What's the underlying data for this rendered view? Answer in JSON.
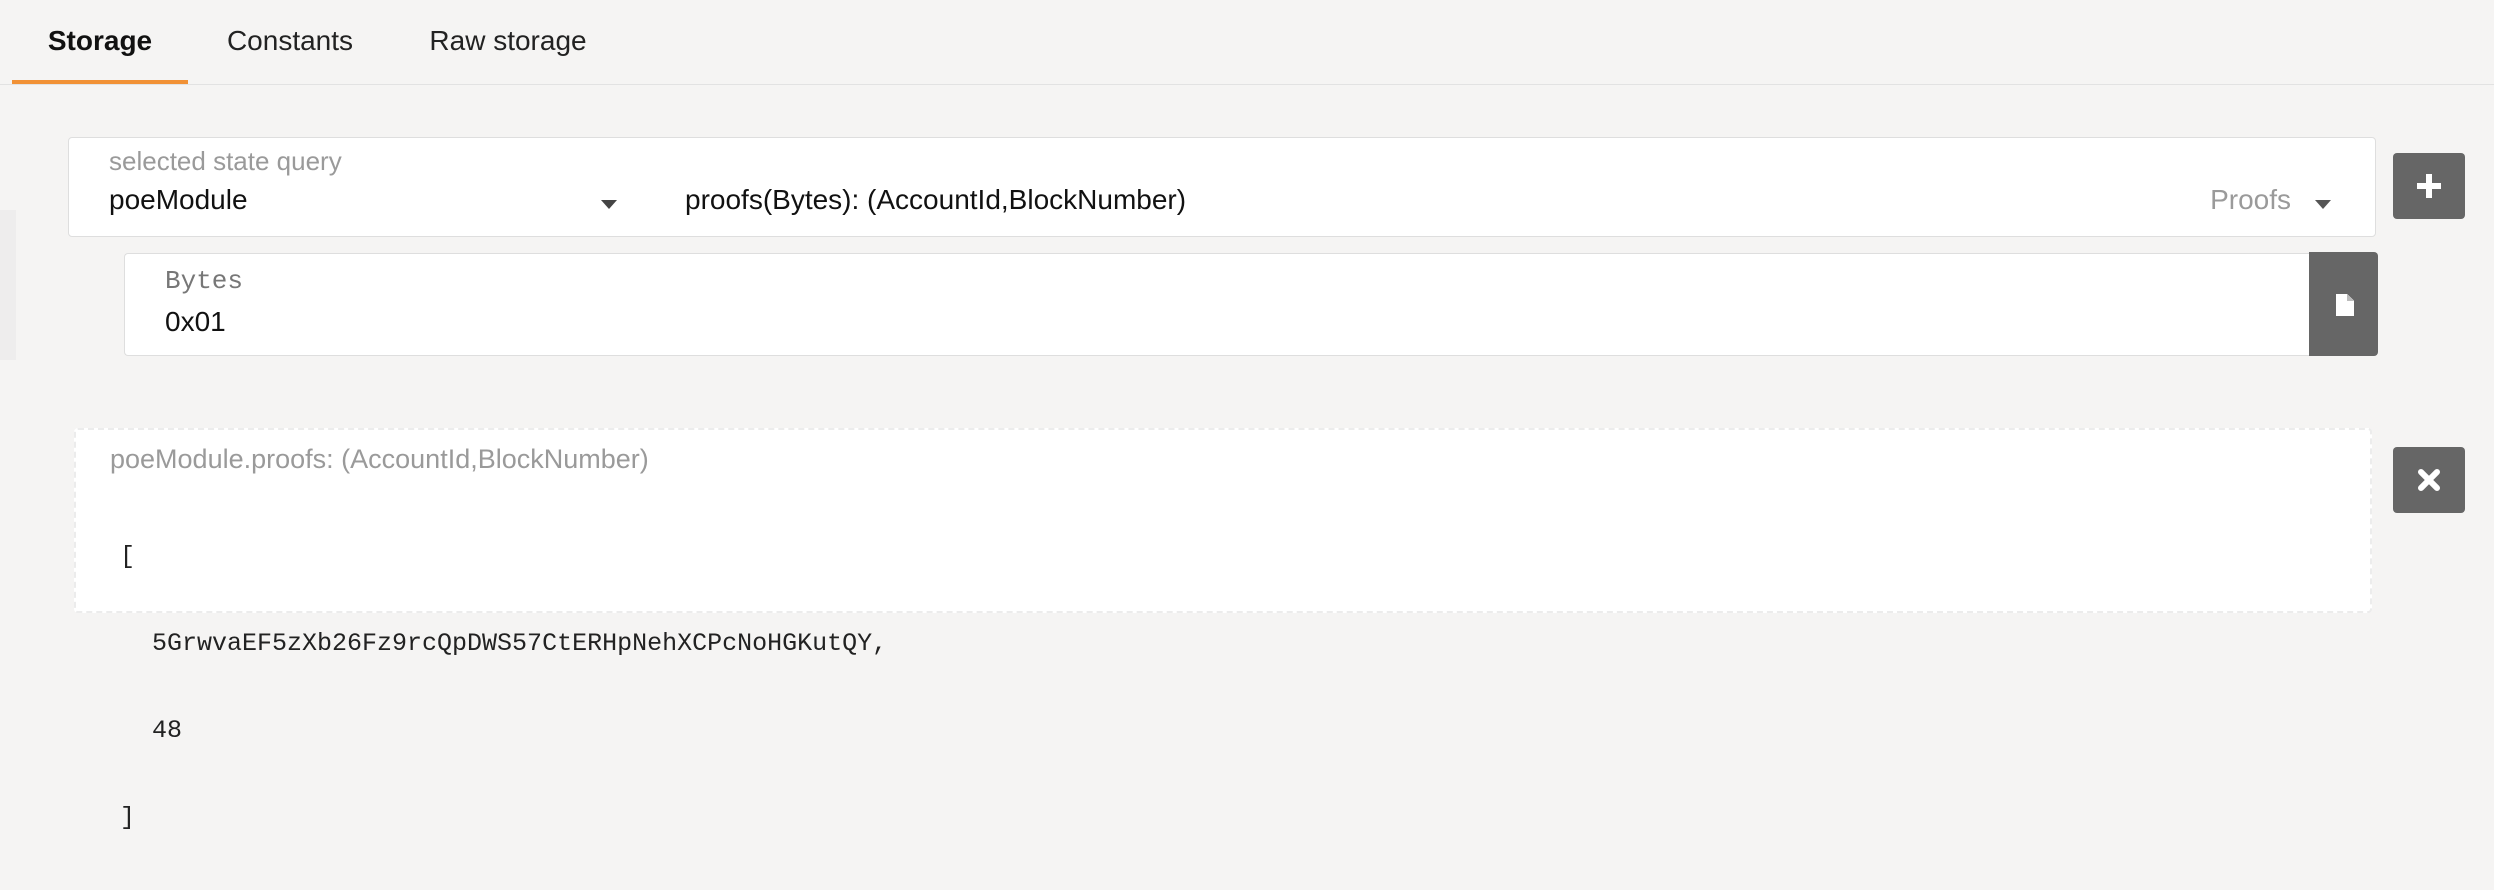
{
  "tabs": [
    {
      "label": "Storage",
      "active": true
    },
    {
      "label": "Constants",
      "active": false
    },
    {
      "label": "Raw storage",
      "active": false
    }
  ],
  "accent_color": "#f19135",
  "query": {
    "label": "selected state query",
    "module": "poeModule",
    "method": "proofs(Bytes): (AccountId,BlockNumber)",
    "section": "Proofs",
    "add_icon": "plus-icon"
  },
  "params": {
    "label": "Bytes",
    "value": "0x01",
    "file_icon": "file-icon"
  },
  "result": {
    "label": "poeModule.proofs: (AccountId,BlockNumber)",
    "lines": [
      "[",
      "5GrwvaEF5zXb26Fz9rcQpDWS57CtERHpNehXCPcNoHGKutQY,",
      "48",
      "]"
    ],
    "close_icon": "close-icon"
  }
}
